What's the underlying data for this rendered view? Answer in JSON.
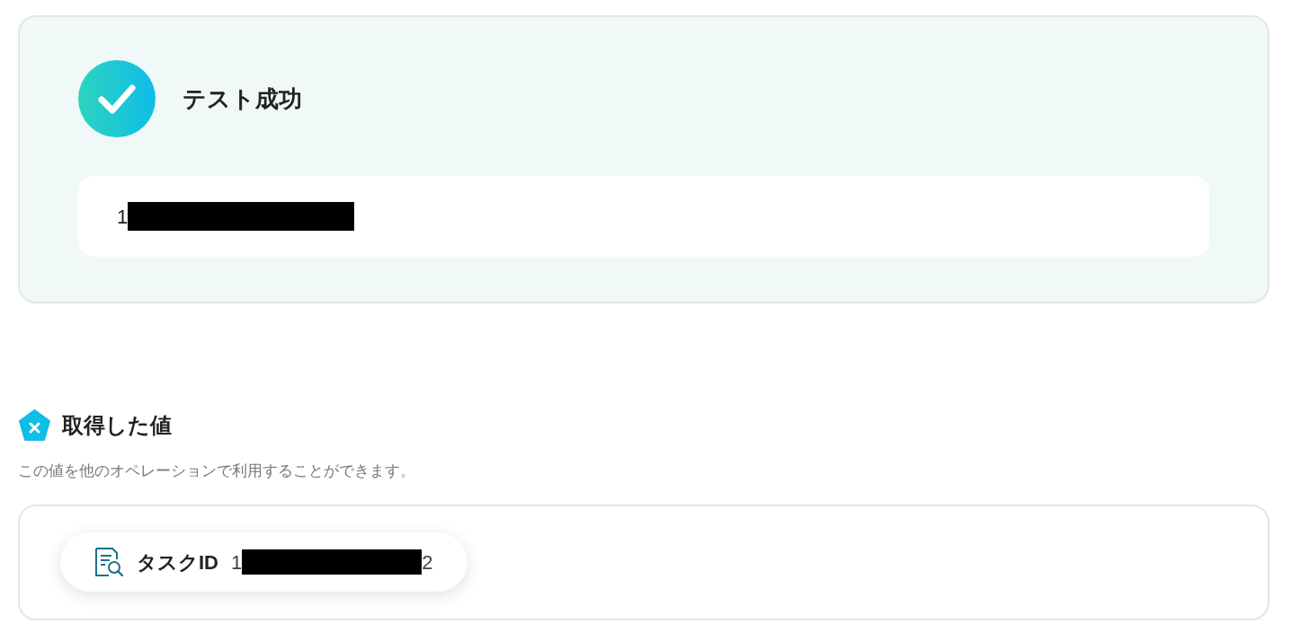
{
  "test_result": {
    "title": "テスト成功",
    "output_start": "1"
  },
  "retrieved_values": {
    "heading": "取得した値",
    "description": "この値を他のオペレーションで利用することができます。",
    "items": [
      {
        "label": "タスクID",
        "value_start": "1",
        "value_end": "2"
      }
    ]
  }
}
